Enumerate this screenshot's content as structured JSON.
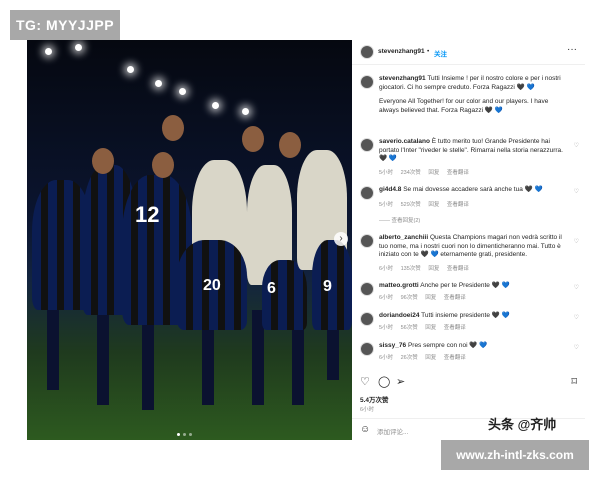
{
  "watermark_top": "TG: MYYJJPP",
  "watermark_mid": "头条 @齐帅",
  "watermark_bottom": "www.zh-intl-zks.com",
  "post": {
    "username": "stevenzhang91",
    "follow_label": "关注",
    "more_icon": "more-horizontal-icon",
    "caption": "Tutti Insieme ! per il nostro colore e per i nostri giocatori. Ci ho sempre creduto. Forza Ragazzi 🖤 💙",
    "caption_en": "Everyone All Together! for our color and our players. I have always believed that. Forza Ragazzi 🖤 💙",
    "photo_numbers": [
      "12",
      "20",
      "6",
      "9"
    ]
  },
  "comments": [
    {
      "user": "saverio.catalano",
      "text": "È tutto merito tuo! Grande Presidente hai portato l'Inter \"riveder le stelle\". Rimarrai nella storia nerazzurra. 🖤 💙",
      "time": "5小时",
      "likes": "234次赞",
      "reply": "回复",
      "translate": "查看翻译"
    },
    {
      "user": "gi4d4.8",
      "text": "Se mai dovesse accadere sarà anche tua 🖤 💙",
      "time": "5小时",
      "likes": "529次赞",
      "reply": "回复",
      "translate": "查看翻译",
      "view_replies": "—— 查看回复(2)"
    },
    {
      "user": "alberto_zanchiii",
      "text": "Questa Champions magari non vedrà scritto il tuo nome, ma i nostri cuori non lo dimenticheranno mai. Tutto è iniziato con te 🖤 💙 eternamente grati, presidente.",
      "time": "6小时",
      "likes": "135次赞",
      "reply": "回复",
      "translate": "查看翻译"
    },
    {
      "user": "matteo.grotti",
      "text": "Anche per te Presidente 🖤 💙",
      "time": "6小时",
      "likes": "96次赞",
      "reply": "回复",
      "translate": "查看翻译"
    },
    {
      "user": "doriandoei24",
      "text": "Tutti insieme presidente 🖤 💙",
      "time": "5小时",
      "likes": "56次赞",
      "reply": "回复",
      "translate": "查看翻译"
    },
    {
      "user": "sissy_76",
      "text": "Pres sempre con noi 🖤 💙",
      "time": "6小时",
      "likes": "26次赞",
      "reply": "回复",
      "translate": "查看翻译"
    }
  ],
  "actions": {
    "like_icon": "heart-icon",
    "comment_icon": "comment-icon",
    "share_icon": "share-icon",
    "save_icon": "bookmark-icon"
  },
  "likes_total": "5.4万次赞",
  "post_time": "6小时",
  "add_comment_placeholder": "添加评论...",
  "colors": {
    "accent": "#0095f6",
    "inter_blue": "#0b1d52",
    "muted": "#8e8e8e"
  }
}
